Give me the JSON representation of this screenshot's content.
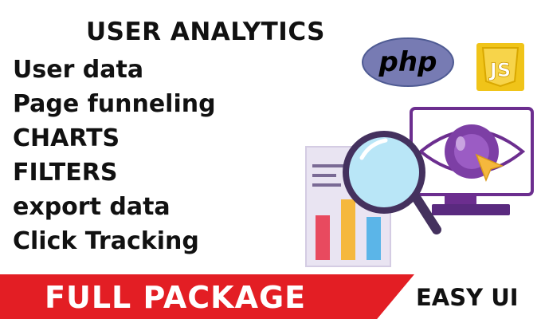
{
  "title": "USER ANALYTICS",
  "features": [
    "User data",
    "Page funneling",
    "CHARTS",
    "FILTERS",
    "export data",
    "Click Tracking"
  ],
  "logos": {
    "php_text": "php",
    "js_text": "JS"
  },
  "banner": {
    "main": "FULL PACKAGE",
    "side": "EASY UI"
  },
  "icons": [
    "php-logo-icon",
    "js-logo-icon",
    "report-document-icon",
    "magnifying-glass-icon",
    "monitor-eye-icon",
    "cursor-arrow-icon"
  ],
  "colors": {
    "banner_red": "#e31e24",
    "php_purple": "#777bb3",
    "js_yellow": "#f0c419",
    "illustration_purple": "#6c2e8f",
    "magnifier_blue": "#b9e6f7"
  }
}
